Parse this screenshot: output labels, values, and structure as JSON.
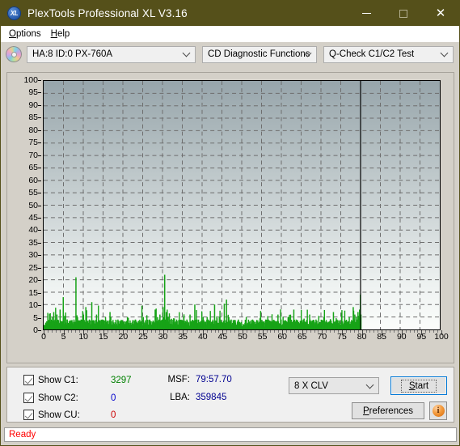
{
  "window": {
    "title": "PlexTools Professional XL V3.16",
    "icon": "xl-logo-icon",
    "minimize": "—",
    "maximize": "□",
    "close": "✕"
  },
  "menubar": {
    "items": [
      {
        "label": "Options"
      },
      {
        "label": "Help"
      }
    ]
  },
  "toolbar": {
    "disc_icon": "cd-disc-icon",
    "drive_select": {
      "value": "HA:8 ID:0  PX-760A"
    },
    "function_select": {
      "value": "CD Diagnostic Functions"
    },
    "test_select": {
      "value": "Q-Check C1/C2 Test"
    }
  },
  "controls": {
    "checkboxes": [
      {
        "label": "Show C1:",
        "checked": true,
        "value": "3297",
        "color": "#008000"
      },
      {
        "label": "Show C2:",
        "checked": true,
        "value": "0",
        "color": "#0000cc"
      },
      {
        "label": "Show CU:",
        "checked": true,
        "value": "0",
        "color": "#cc0000"
      }
    ],
    "msf_label": "MSF:",
    "msf_value": "79:57.70",
    "lba_label": "LBA:",
    "lba_value": "359845",
    "speed_select": {
      "value": "8 X CLV"
    },
    "start_button": "Start",
    "preferences_button": "Preferences",
    "info_button": "info-icon"
  },
  "statusbar": {
    "text": "Ready"
  },
  "colors": {
    "titlebar": "#55501a",
    "c1_series": "#17a317",
    "accent_focus": "#0078d7",
    "status_text": "#ff0000",
    "value_text": "#000090"
  },
  "chart_data": {
    "type": "bar",
    "title": "",
    "xlabel": "",
    "ylabel": "",
    "xlim": [
      0,
      100
    ],
    "ylim": [
      0,
      100
    ],
    "xticks": [
      0,
      5,
      10,
      15,
      20,
      25,
      30,
      35,
      40,
      45,
      50,
      55,
      60,
      65,
      70,
      75,
      80,
      85,
      90,
      95,
      100
    ],
    "yticks": [
      0,
      5,
      10,
      15,
      20,
      25,
      30,
      35,
      40,
      45,
      50,
      55,
      60,
      65,
      70,
      75,
      80,
      85,
      90,
      95,
      100
    ],
    "grid": true,
    "legend": false,
    "data_end_marker_x": 80,
    "series": [
      {
        "name": "C1",
        "color": "#17a317",
        "points": [
          [
            0.2,
            1
          ],
          [
            0.5,
            2
          ],
          [
            0.8,
            1
          ],
          [
            1.1,
            3
          ],
          [
            1.4,
            1
          ],
          [
            1.7,
            2
          ],
          [
            2.0,
            5
          ],
          [
            2.2,
            2
          ],
          [
            2.4,
            7
          ],
          [
            2.6,
            2
          ],
          [
            2.8,
            4
          ],
          [
            3.0,
            2
          ],
          [
            3.2,
            6
          ],
          [
            3.4,
            2
          ],
          [
            3.6,
            3
          ],
          [
            3.8,
            1
          ],
          [
            4.0,
            8
          ],
          [
            4.2,
            2
          ],
          [
            4.4,
            3
          ],
          [
            4.6,
            1
          ],
          [
            4.8,
            13
          ],
          [
            5.0,
            2
          ],
          [
            5.2,
            3
          ],
          [
            5.4,
            1
          ],
          [
            5.6,
            2
          ],
          [
            5.8,
            4
          ],
          [
            6.0,
            2
          ],
          [
            6.3,
            1
          ],
          [
            6.6,
            3
          ],
          [
            6.9,
            1
          ],
          [
            7.2,
            2
          ],
          [
            7.5,
            4
          ],
          [
            7.8,
            1
          ],
          [
            8.0,
            21
          ],
          [
            8.2,
            3
          ],
          [
            8.4,
            5
          ],
          [
            8.6,
            2
          ],
          [
            8.8,
            3
          ],
          [
            9.0,
            1
          ],
          [
            9.3,
            4
          ],
          [
            9.6,
            2
          ],
          [
            9.9,
            6
          ],
          [
            10.2,
            2
          ],
          [
            10.5,
            9
          ],
          [
            10.8,
            3
          ],
          [
            11.1,
            2
          ],
          [
            11.4,
            4
          ],
          [
            11.7,
            2
          ],
          [
            12.0,
            11
          ],
          [
            12.3,
            2
          ],
          [
            12.6,
            3
          ],
          [
            12.9,
            2
          ],
          [
            13.2,
            6
          ],
          [
            13.5,
            2
          ],
          [
            13.8,
            1
          ],
          [
            14.1,
            3
          ],
          [
            14.4,
            2
          ],
          [
            14.7,
            4
          ],
          [
            15.0,
            2
          ],
          [
            15.4,
            1
          ],
          [
            15.8,
            3
          ],
          [
            16.2,
            2
          ],
          [
            16.6,
            7
          ],
          [
            17.0,
            2
          ],
          [
            17.4,
            3
          ],
          [
            17.8,
            1
          ],
          [
            18.2,
            2
          ],
          [
            18.6,
            4
          ],
          [
            19.0,
            2
          ],
          [
            19.4,
            3
          ],
          [
            19.8,
            1
          ],
          [
            20.2,
            2
          ],
          [
            20.6,
            3
          ],
          [
            21.0,
            5
          ],
          [
            21.4,
            2
          ],
          [
            21.8,
            1
          ],
          [
            22.2,
            3
          ],
          [
            22.6,
            2
          ],
          [
            23.0,
            4
          ],
          [
            23.4,
            2
          ],
          [
            23.8,
            3
          ],
          [
            24.2,
            1
          ],
          [
            24.6,
            2
          ],
          [
            25.0,
            5
          ],
          [
            25.4,
            2
          ],
          [
            25.8,
            3
          ],
          [
            26.2,
            2
          ],
          [
            26.6,
            4
          ],
          [
            27.0,
            2
          ],
          [
            27.4,
            3
          ],
          [
            27.8,
            1
          ],
          [
            28.0,
            8
          ],
          [
            28.3,
            3
          ],
          [
            28.6,
            5
          ],
          [
            28.9,
            2
          ],
          [
            29.2,
            6
          ],
          [
            29.5,
            3
          ],
          [
            29.8,
            4
          ],
          [
            30.0,
            9
          ],
          [
            30.2,
            5
          ],
          [
            30.4,
            22
          ],
          [
            30.6,
            4
          ],
          [
            30.8,
            7
          ],
          [
            31.0,
            3
          ],
          [
            31.3,
            5
          ],
          [
            31.6,
            2
          ],
          [
            31.9,
            4
          ],
          [
            32.2,
            2
          ],
          [
            32.5,
            3
          ],
          [
            32.8,
            1
          ],
          [
            33.1,
            2
          ],
          [
            33.4,
            4
          ],
          [
            33.7,
            2
          ],
          [
            34.0,
            3
          ],
          [
            34.4,
            1
          ],
          [
            34.8,
            2
          ],
          [
            35.2,
            5
          ],
          [
            35.6,
            2
          ],
          [
            36.0,
            4
          ],
          [
            36.4,
            2
          ],
          [
            36.8,
            6
          ],
          [
            37.2,
            2
          ],
          [
            37.6,
            3
          ],
          [
            38.0,
            10
          ],
          [
            38.3,
            2
          ],
          [
            38.6,
            4
          ],
          [
            38.9,
            2
          ],
          [
            39.2,
            3
          ],
          [
            39.5,
            1
          ],
          [
            39.8,
            2
          ],
          [
            40.1,
            5
          ],
          [
            40.4,
            2
          ],
          [
            40.7,
            3
          ],
          [
            41.0,
            2
          ],
          [
            41.4,
            4
          ],
          [
            41.8,
            2
          ],
          [
            42.2,
            3
          ],
          [
            42.6,
            1
          ],
          [
            43.0,
            10
          ],
          [
            43.3,
            2
          ],
          [
            43.6,
            3
          ],
          [
            43.9,
            2
          ],
          [
            44.2,
            5
          ],
          [
            44.5,
            2
          ],
          [
            44.8,
            3
          ],
          [
            45.2,
            1
          ],
          [
            45.6,
            2
          ],
          [
            46.0,
            12
          ],
          [
            46.3,
            3
          ],
          [
            46.6,
            5
          ],
          [
            46.9,
            2
          ],
          [
            47.2,
            4
          ],
          [
            47.5,
            2
          ],
          [
            47.8,
            3
          ],
          [
            48.2,
            1
          ],
          [
            48.6,
            2
          ],
          [
            49.0,
            4
          ],
          [
            49.4,
            2
          ],
          [
            49.8,
            3
          ],
          [
            50.2,
            1
          ],
          [
            50.6,
            2
          ],
          [
            51.0,
            5
          ],
          [
            51.4,
            2
          ],
          [
            51.8,
            3
          ],
          [
            52.2,
            2
          ],
          [
            52.6,
            4
          ],
          [
            53.0,
            2
          ],
          [
            53.4,
            1
          ],
          [
            53.8,
            3
          ],
          [
            54.2,
            2
          ],
          [
            54.6,
            5
          ],
          [
            55.0,
            2
          ],
          [
            55.4,
            3
          ],
          [
            55.8,
            1
          ],
          [
            56.2,
            2
          ],
          [
            56.6,
            4
          ],
          [
            57.0,
            2
          ],
          [
            57.4,
            3
          ],
          [
            57.8,
            2
          ],
          [
            58.2,
            1
          ],
          [
            58.6,
            3
          ],
          [
            59.0,
            6
          ],
          [
            59.4,
            2
          ],
          [
            59.8,
            4
          ],
          [
            60.2,
            2
          ],
          [
            60.6,
            3
          ],
          [
            61.0,
            1
          ],
          [
            61.4,
            2
          ],
          [
            61.8,
            5
          ],
          [
            62.2,
            2
          ],
          [
            62.6,
            3
          ],
          [
            63.0,
            8
          ],
          [
            63.3,
            2
          ],
          [
            63.6,
            4
          ],
          [
            63.9,
            2
          ],
          [
            64.2,
            3
          ],
          [
            64.6,
            1
          ],
          [
            65.0,
            2
          ],
          [
            65.4,
            4
          ],
          [
            65.8,
            2
          ],
          [
            66.2,
            3
          ],
          [
            66.6,
            1
          ],
          [
            67.0,
            6
          ],
          [
            67.4,
            2
          ],
          [
            67.8,
            3
          ],
          [
            68.2,
            2
          ],
          [
            68.6,
            4
          ],
          [
            69.0,
            2
          ],
          [
            69.4,
            3
          ],
          [
            69.8,
            1
          ],
          [
            70.2,
            2
          ],
          [
            70.6,
            5
          ],
          [
            71.0,
            2
          ],
          [
            71.4,
            3
          ],
          [
            71.8,
            2
          ],
          [
            72.2,
            4
          ],
          [
            72.6,
            2
          ],
          [
            73.0,
            7
          ],
          [
            73.3,
            3
          ],
          [
            73.6,
            2
          ],
          [
            73.9,
            4
          ],
          [
            74.2,
            2
          ],
          [
            74.6,
            3
          ],
          [
            75.0,
            1
          ],
          [
            75.4,
            2
          ],
          [
            75.8,
            4
          ],
          [
            76.2,
            2
          ],
          [
            76.6,
            3
          ],
          [
            77.0,
            5
          ],
          [
            77.4,
            2
          ],
          [
            77.8,
            3
          ],
          [
            78.0,
            9
          ],
          [
            78.2,
            4
          ],
          [
            78.4,
            6
          ],
          [
            78.6,
            3
          ],
          [
            78.8,
            5
          ],
          [
            79.0,
            4
          ],
          [
            79.2,
            7
          ],
          [
            79.4,
            5
          ],
          [
            79.6,
            8
          ],
          [
            79.8,
            14
          ],
          [
            79.95,
            6
          ]
        ],
        "baseline_height": 1
      }
    ]
  }
}
